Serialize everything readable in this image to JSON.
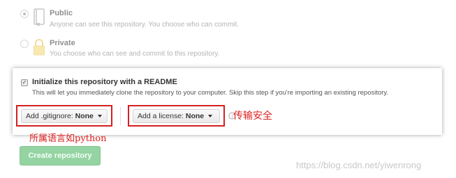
{
  "visibility": {
    "public": {
      "title": "Public",
      "description": "Anyone can see this repository. You choose who can commit.",
      "selected": true,
      "icon": "repo-icon"
    },
    "private": {
      "title": "Private",
      "description": "You choose who can see and commit to this repository.",
      "selected": false,
      "icon": "lock-icon"
    }
  },
  "init": {
    "checked": true,
    "check_mark": "✓",
    "title": "Initialize this repository with a README",
    "description": "This will let you immediately clone the repository to your computer. Skip this step if you're importing an existing repository."
  },
  "gitignore": {
    "label": "Add .gitignore:",
    "value": "None"
  },
  "license": {
    "label": "Add a license:",
    "value": "None"
  },
  "annotations": {
    "gitignore_note": "所属语言如python",
    "license_note": "传输安全",
    "annotation_color": "#e02020"
  },
  "create_button": {
    "label": "Create repository"
  },
  "watermark": "https://blog.csdn.net/yiwenrong",
  "colors": {
    "create_button_bg": "#94d3a2",
    "highlight_red": "#d42020"
  }
}
